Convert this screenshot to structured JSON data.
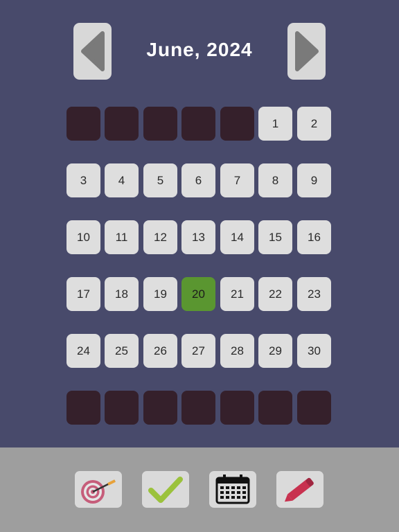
{
  "header": {
    "month_title": "June, 2024",
    "prev_icon": "triangle-left-icon",
    "next_icon": "triangle-right-icon"
  },
  "calendar": {
    "selected_day": "20",
    "weeks": [
      [
        "",
        "",
        "",
        "",
        "",
        "1",
        "2"
      ],
      [
        "3",
        "4",
        "5",
        "6",
        "7",
        "8",
        "9"
      ],
      [
        "10",
        "11",
        "12",
        "13",
        "14",
        "15",
        "16"
      ],
      [
        "17",
        "18",
        "19",
        "20",
        "21",
        "22",
        "23"
      ],
      [
        "24",
        "25",
        "26",
        "27",
        "28",
        "29",
        "30"
      ],
      [
        "",
        "",
        "",
        "",
        "",
        "",
        ""
      ]
    ]
  },
  "colors": {
    "background": "#484a6b",
    "day_cell": "#dedede",
    "empty_cell": "#35202b",
    "selected_cell": "#5a9630",
    "toolbar": "#9e9e9e"
  },
  "toolbar": {
    "items": [
      {
        "icon": "target-icon"
      },
      {
        "icon": "checkmark-icon"
      },
      {
        "icon": "calendar-icon"
      },
      {
        "icon": "pencil-icon"
      }
    ]
  }
}
